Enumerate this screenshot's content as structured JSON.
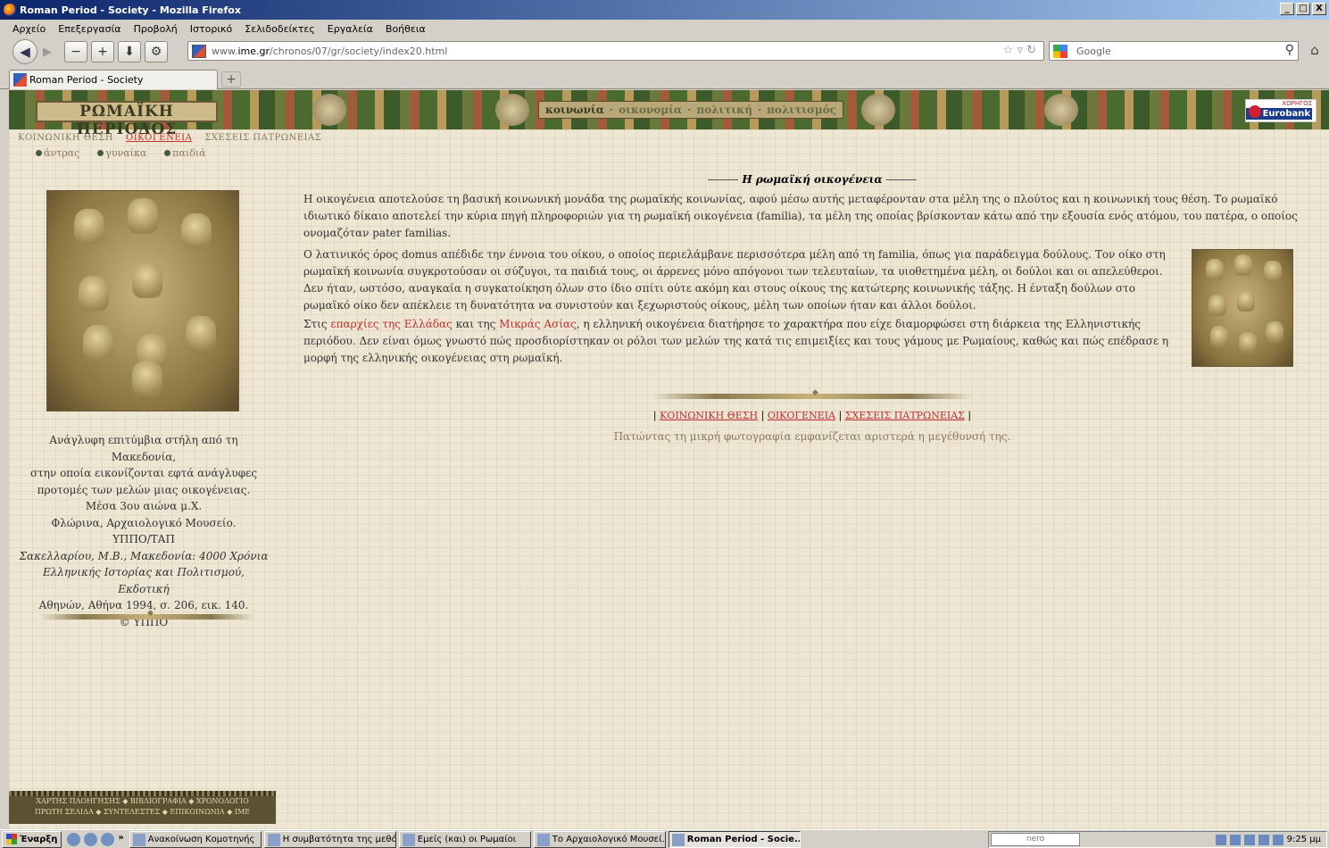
{
  "window": {
    "title": "Roman Period - Society - Mozilla Firefox",
    "min": "_",
    "max": "□",
    "close": "X"
  },
  "menu": [
    "Αρχείο",
    "Επεξεργασία",
    "Προβολή",
    "Ιστορικό",
    "Σελιδοδείκτες",
    "Εργαλεία",
    "Βοήθεια"
  ],
  "nav": {
    "url_prefix": "www.",
    "url_domain": "ime.gr",
    "url_path": "/chronos/07/gr/society/index20.html",
    "search_placeholder": "Google"
  },
  "tab": {
    "title": "Roman Period - Society",
    "new_tab": "+"
  },
  "site": {
    "banner_title": "ΡΩΜΑΪΚΗ ΠΕΡΙΟΔΟΣ",
    "sections": [
      "κοινωνία",
      "οικονομία",
      "πολιτική",
      "πολιτισμός"
    ],
    "sponsor_label": "ΧΟΡΗΓΟΣ",
    "sponsor_name": "Eurobank",
    "subnav": [
      "ΚΟΙΝΩΝΙΚΗ ΘΕΣΗ",
      "ΟΙΚΟΓΕΝΕΙΑ",
      "ΣΧΕΣΕΙΣ ΠΑΤΡΩΝΕΙΑΣ"
    ],
    "subsub": [
      "άντρας",
      "γυναίκα",
      "παιδιά"
    ],
    "caption_lines": [
      "Ανάγλυφη επιτύμβια στήλη από τη Μακεδονία,",
      "στην οποία εικονίζονται εφτά ανάγλυφες",
      "προτομές των μελών μιας οικογένειας.",
      "Μέσα 3ου αιώνα μ.Χ.",
      "Φλώρινα, Αρχαιολογικό Μουσείο.",
      "ΥΠΠΟ/ΤΑΠ",
      "Σακελλαρίου, Μ.Β., Μακεδονία: 4000 Χρόνια",
      "Ελληνικής Ιστορίας και Πολιτισμού, Εκδοτική",
      "Αθηνών, Αθήνα 1994, σ. 206, εικ. 140.",
      "© ΥΠΠΟ"
    ],
    "heading": "Η ρωμαϊκή οικογένεια",
    "para1": "Η οικογένεια αποτελούσε τη βασική κοινωνική μονάδα της ρωμαϊκής κοινωνίας, αφού μέσω αυτής μεταφέρονταν στα μέλη της ο πλούτος και η κοινωνική τους θέση. Το ρωμαϊκό ιδιωτικό δίκαιο αποτελεί την κύρια πηγή πληροφοριών για τη ρωμαϊκή οικογένεια (familia), τα μέλη της οποίας βρίσκονταν κάτω από την εξουσία ενός ατόμου, του πατέρα, ο οποίος ονομαζόταν pater familias.",
    "para2": "Ο λατινικός όρος domus απέδιδε την έννοια του οίκου, ο οποίος περιελάμβανε περισσότερα μέλη από τη familia, όπως για παράδειγμα δούλους. Τον οίκο στη ρωμαϊκή κοινωνία συγκροτούσαν οι σύζυγοι, τα παιδιά τους, οι άρρενες μόνο απόγονοι των τελευταίων, τα υιοθετημένα μέλη, οι δούλοι και οι απελεύθεροι. Δεν ήταν, ωστόσο, αναγκαία η συγκατοίκηση όλων στο ίδιο σπίτι ούτε ακόμη και στους οίκους της κατώτερης κοινωνικής τάξης. Η ένταξη δούλων στο ρωμαϊκό οίκο δεν απέκλειε τη δυνατότητα να συνιστούν και ξεχωριστούς οίκους, μέλη των οποίων ήταν και άλλοι δούλοι.",
    "para3_a": "Στις ",
    "para3_link1": "επαρχίες της Ελλάδας",
    "para3_b": " και της ",
    "para3_link2": "Μικράς Ασίας",
    "para3_c": ", η ελληνική οικογένεια διατήρησε το χαρακτήρα που είχε διαμορφώσει στη διάρκεια της Ελληνιστικής περιόδου. Δεν είναι όμως γνωστό πώς προσδιορίστηκαν οι ρόλοι των μελών της κατά τις επιμειξίες και τους γάμους με Ρωμαίους, καθώς και πώς επέδρασε η μορφή της ελληνικής οικογένειας στη ρωμαϊκή.",
    "bottom_links": [
      "ΚΟΙΝΩΝΙΚΗ ΘΕΣΗ",
      "ΟΙΚΟΓΕΝΕΙΑ",
      "ΣΧΕΣΕΙΣ ΠΑΤΡΩΝΕΙΑΣ"
    ],
    "note": "Πατώντας τη μικρή φωτογραφία εμφανίζεται αριστερά η μεγέθυνσή της.",
    "footer_line1": "ΧΑΡΤΗΣ ΠΛΟΗΓΗΣΗΣ ◆ ΒΙΒΛΙΟΓΡΑΦΙΑ ◆ ΧΡΟΝΟΛΟΓΙΟ",
    "footer_line2": "ΠΡΩΤΗ ΣΕΛΙΔΑ ◆ ΣΥΝΤΕΛΕΣΤΕΣ ◆ ΕΠΙΚΟΙΝΩΝΙΑ ◆ ΙΜΕ"
  },
  "taskbar": {
    "start": "Έναρξη",
    "more": "»",
    "tasks": [
      "Ανακοίνωση Κομοτηνής",
      "Η συμβατότητα της μεθό...",
      "Εμείς (και) οι Ρωμαίοι",
      "Το Αρχαιολογικό Μουσεί...",
      "Roman Period - Socie..."
    ],
    "search_brand": "nero",
    "clock": "9:25 μμ"
  }
}
